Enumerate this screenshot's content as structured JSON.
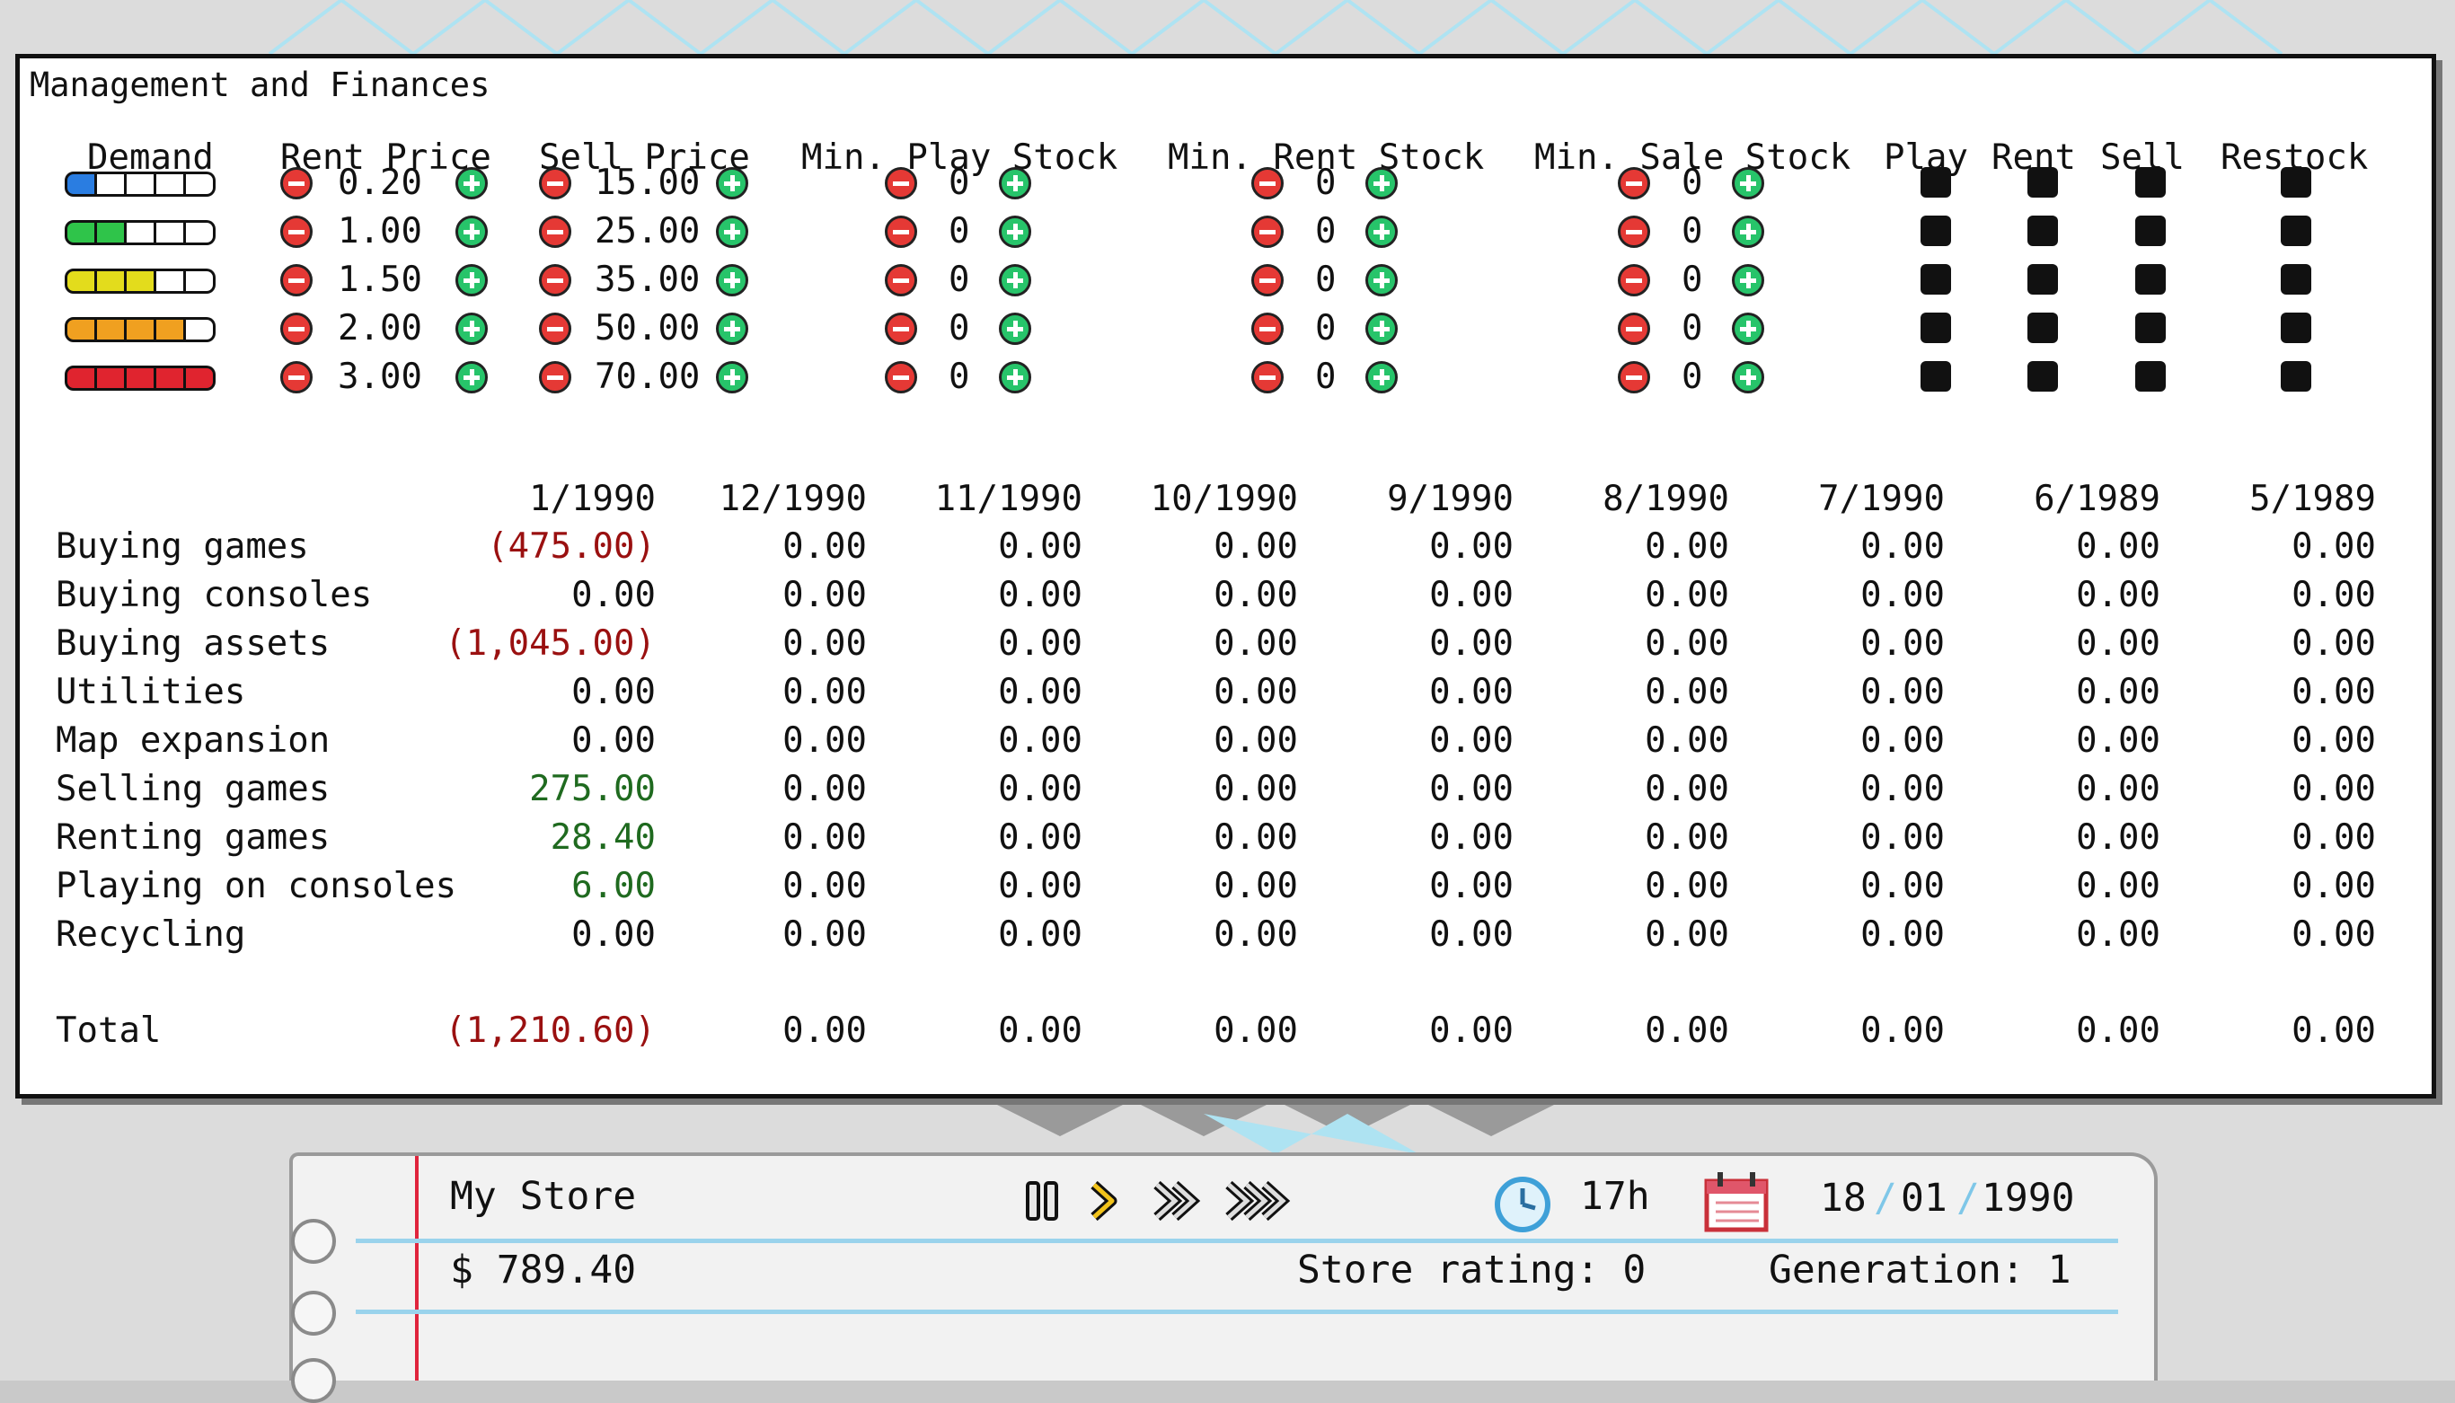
{
  "panel": {
    "title": "Management and Finances",
    "headers": {
      "demand": "Demand",
      "rent_price": "Rent Price",
      "sell_price": "Sell Price",
      "min_play_stock": "Min. Play Stock",
      "min_rent_stock": "Min. Rent Stock",
      "min_sale_stock": "Min. Sale Stock",
      "play": "Play",
      "rent": "Rent",
      "sell": "Sell",
      "restock": "Restock"
    },
    "tiers": [
      {
        "demand_level": 1,
        "demand_color": "#2a7de1",
        "rent_price": "0.20",
        "sell_price": "15.00",
        "min_play_stock": "0",
        "min_rent_stock": "0",
        "min_sale_stock": "0"
      },
      {
        "demand_level": 2,
        "demand_color": "#2fc44a",
        "rent_price": "1.00",
        "sell_price": "25.00",
        "min_play_stock": "0",
        "min_rent_stock": "0",
        "min_sale_stock": "0"
      },
      {
        "demand_level": 3,
        "demand_color": "#e3dc1c",
        "rent_price": "1.50",
        "sell_price": "35.00",
        "min_play_stock": "0",
        "min_rent_stock": "0",
        "min_sale_stock": "0"
      },
      {
        "demand_level": 4,
        "demand_color": "#f0a020",
        "rent_price": "2.00",
        "sell_price": "50.00",
        "min_play_stock": "0",
        "min_rent_stock": "0",
        "min_sale_stock": "0"
      },
      {
        "demand_level": 5,
        "demand_color": "#e0242f",
        "rent_price": "3.00",
        "sell_price": "70.00",
        "min_play_stock": "0",
        "min_rent_stock": "0",
        "min_sale_stock": "0"
      }
    ],
    "finance": {
      "months": [
        "1/1990",
        "12/1990",
        "11/1990",
        "10/1990",
        "9/1990",
        "8/1990",
        "7/1990",
        "6/1989",
        "5/1989"
      ],
      "rows": [
        {
          "label": "Buying games",
          "current": "(475.00)",
          "tone": "neg"
        },
        {
          "label": "Buying consoles",
          "current": "0.00",
          "tone": ""
        },
        {
          "label": "Buying assets",
          "current": "(1,045.00)",
          "tone": "neg"
        },
        {
          "label": "Utilities",
          "current": "0.00",
          "tone": ""
        },
        {
          "label": "Map expansion",
          "current": "0.00",
          "tone": ""
        },
        {
          "label": "Selling games",
          "current": "275.00",
          "tone": "pos"
        },
        {
          "label": "Renting games",
          "current": "28.40",
          "tone": "pos"
        },
        {
          "label": "Playing on consoles",
          "current": "6.00",
          "tone": "pos"
        },
        {
          "label": "Recycling",
          "current": "0.00",
          "tone": ""
        }
      ],
      "history_value": "0.00",
      "total": {
        "label": "Total",
        "current": "(1,210.60)",
        "tone": "neg"
      }
    }
  },
  "status_bar": {
    "store_name": "My Store",
    "money": "$ 789.40",
    "time": "17h",
    "date_day": "18",
    "date_month": "01",
    "date_year": "1990",
    "date_sep": "/",
    "store_rating": "Store rating: 0",
    "generation": "Generation: 1",
    "speed_icons": [
      "pause-icon",
      "play-speed-1-icon",
      "play-speed-2-icon",
      "play-speed-3-icon"
    ],
    "clock_icon": "clock-icon",
    "calendar_icon": "calendar-icon"
  },
  "colors": {
    "negative": "#9a1010",
    "positive": "#1f6a1f",
    "minus_button": "#e53935",
    "plus_button": "#27c46a",
    "accent_line": "#9ad3ec",
    "margin_line": "#e0243c"
  }
}
